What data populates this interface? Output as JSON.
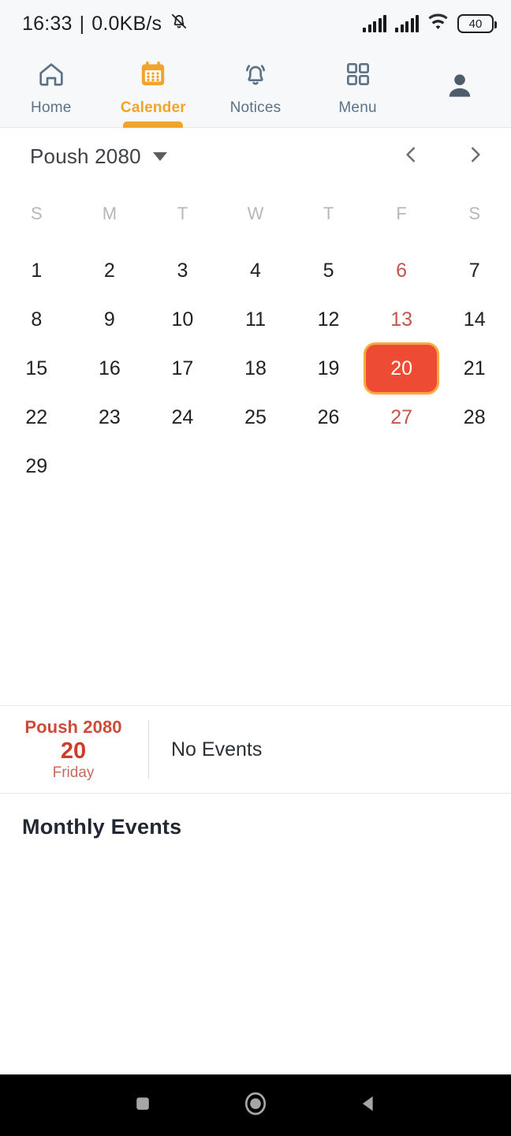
{
  "status_bar": {
    "time": "16:33",
    "separator": "|",
    "network_speed": "0.0KB/s",
    "mute_icon": "bell-muted-icon",
    "signal_1_icon": "signal-bars-icon",
    "signal_2_icon": "signal-bars-icon",
    "wifi_icon": "wifi-icon",
    "battery_level": "40"
  },
  "topnav": {
    "tabs": [
      {
        "label": "Home",
        "icon": "home-icon",
        "active": false
      },
      {
        "label": "Calender",
        "icon": "calendar-icon",
        "active": true
      },
      {
        "label": "Notices",
        "icon": "bell-icon",
        "active": false
      },
      {
        "label": "Menu",
        "icon": "grid-icon",
        "active": false
      }
    ],
    "profile_icon": "person-icon"
  },
  "calendar": {
    "month_title": "Poush 2080",
    "dropdown_icon": "chevron-down-icon",
    "prev_icon": "chevron-left-icon",
    "next_icon": "chevron-right-icon",
    "weekdays": [
      "S",
      "M",
      "T",
      "W",
      "T",
      "F",
      "S"
    ],
    "weeks": [
      [
        {
          "d": "1",
          "holiday": false,
          "selected": false
        },
        {
          "d": "2",
          "holiday": false,
          "selected": false
        },
        {
          "d": "3",
          "holiday": false,
          "selected": false
        },
        {
          "d": "4",
          "holiday": false,
          "selected": false
        },
        {
          "d": "5",
          "holiday": false,
          "selected": false
        },
        {
          "d": "6",
          "holiday": true,
          "selected": false
        },
        {
          "d": "7",
          "holiday": false,
          "selected": false
        }
      ],
      [
        {
          "d": "8",
          "holiday": false,
          "selected": false
        },
        {
          "d": "9",
          "holiday": false,
          "selected": false
        },
        {
          "d": "10",
          "holiday": false,
          "selected": false
        },
        {
          "d": "11",
          "holiday": false,
          "selected": false
        },
        {
          "d": "12",
          "holiday": false,
          "selected": false
        },
        {
          "d": "13",
          "holiday": true,
          "selected": false
        },
        {
          "d": "14",
          "holiday": false,
          "selected": false
        }
      ],
      [
        {
          "d": "15",
          "holiday": false,
          "selected": false
        },
        {
          "d": "16",
          "holiday": false,
          "selected": false
        },
        {
          "d": "17",
          "holiday": false,
          "selected": false
        },
        {
          "d": "18",
          "holiday": false,
          "selected": false
        },
        {
          "d": "19",
          "holiday": false,
          "selected": false
        },
        {
          "d": "20",
          "holiday": true,
          "selected": true
        },
        {
          "d": "21",
          "holiday": false,
          "selected": false
        }
      ],
      [
        {
          "d": "22",
          "holiday": false,
          "selected": false
        },
        {
          "d": "23",
          "holiday": false,
          "selected": false
        },
        {
          "d": "24",
          "holiday": false,
          "selected": false
        },
        {
          "d": "25",
          "holiday": false,
          "selected": false
        },
        {
          "d": "26",
          "holiday": false,
          "selected": false
        },
        {
          "d": "27",
          "holiday": true,
          "selected": false
        },
        {
          "d": "28",
          "holiday": false,
          "selected": false
        }
      ],
      [
        {
          "d": "29",
          "holiday": false,
          "selected": false
        },
        {
          "d": "",
          "holiday": false,
          "selected": false
        },
        {
          "d": "",
          "holiday": false,
          "selected": false
        },
        {
          "d": "",
          "holiday": false,
          "selected": false
        },
        {
          "d": "",
          "holiday": false,
          "selected": false
        },
        {
          "d": "",
          "holiday": false,
          "selected": false
        },
        {
          "d": "",
          "holiday": false,
          "selected": false
        }
      ]
    ]
  },
  "selected_day": {
    "month_year": "Poush 2080",
    "day_number": "20",
    "day_name": "Friday",
    "events_text": "No Events"
  },
  "monthly_events": {
    "title": "Monthly Events"
  },
  "android_nav": {
    "recents_icon": "square-icon",
    "home_icon": "circle-icon",
    "back_icon": "triangle-back-icon"
  },
  "colors": {
    "accent_orange": "#f0a52a",
    "selected_red": "#ed4b33",
    "holiday_red": "#c1564b",
    "nav_text": "#5d7286",
    "statusbar_bg": "#f7f8fa"
  }
}
